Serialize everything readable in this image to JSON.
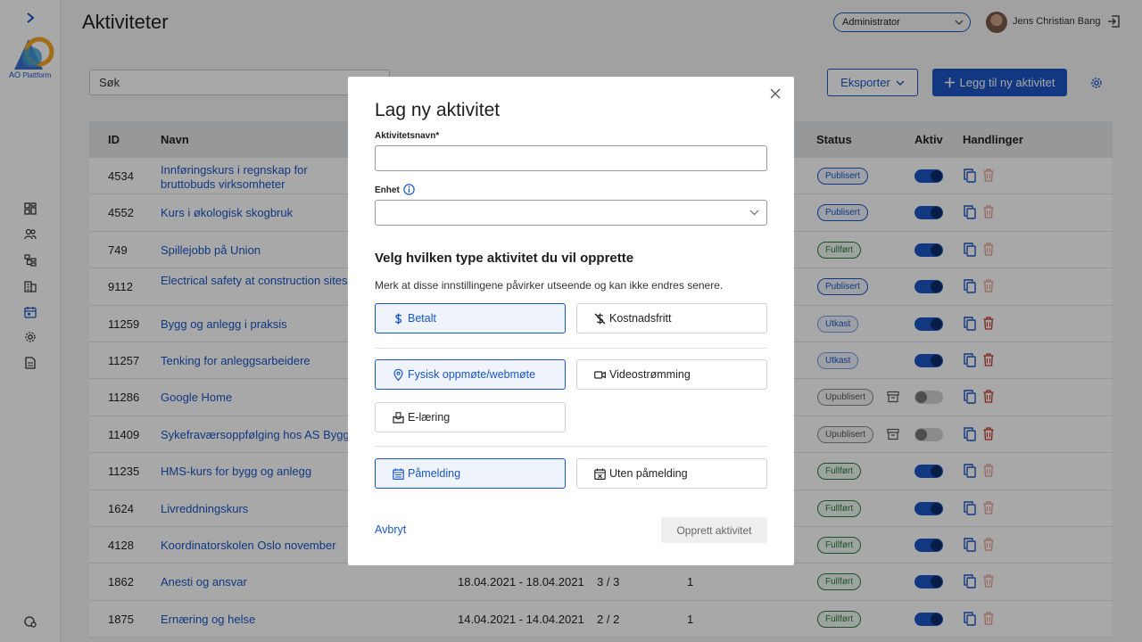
{
  "header": {
    "title": "Aktiviteter",
    "role": "Administrator",
    "user_name": "Jens Christian Bang"
  },
  "logo": {
    "line1": "AO",
    "line2": "Plattform"
  },
  "toolbar": {
    "search_placeholder": "Søk",
    "export_label": "Eksporter",
    "add_label": "Legg til ny aktivitet"
  },
  "table": {
    "columns": {
      "id": "ID",
      "name": "Navn",
      "status": "Status",
      "active": "Aktiv",
      "actions": "Handlinger"
    },
    "rows": [
      {
        "id": "4534",
        "name": "Innføringskurs i regnskap for bruttobuds virksomheter",
        "date": "",
        "seats": "",
        "count": "",
        "status": "Publisert",
        "active": true
      },
      {
        "id": "4552",
        "name": "Kurs i økologisk skogbruk",
        "date": "",
        "seats": "",
        "count": "",
        "status": "Publisert",
        "active": true
      },
      {
        "id": "749",
        "name": "Spillejobb på Union",
        "date": "",
        "seats": "",
        "count": "",
        "status": "Fullført",
        "active": true
      },
      {
        "id": "9112",
        "name": "Electrical safety at construction sites",
        "date": "",
        "seats": "",
        "count": "",
        "status": "Publisert",
        "active": true
      },
      {
        "id": "11259",
        "name": "Bygg og anlegg i praksis",
        "date": "",
        "seats": "",
        "count": "",
        "status": "Utkast",
        "active": true
      },
      {
        "id": "11257",
        "name": "Tenking for anleggsarbeidere",
        "date": "",
        "seats": "",
        "count": "",
        "status": "Utkast",
        "active": true
      },
      {
        "id": "11286",
        "name": "Google Home",
        "date": "",
        "seats": "",
        "count": "",
        "status": "Upublisert",
        "active": false
      },
      {
        "id": "11409",
        "name": "Sykefraværsoppfølging hos AS Bygg",
        "date": "",
        "seats": "",
        "count": "",
        "status": "Upublisert",
        "active": false
      },
      {
        "id": "11235",
        "name": "HMS-kurs for bygg og anlegg",
        "date": "",
        "seats": "",
        "count": "",
        "status": "Fullført",
        "active": true
      },
      {
        "id": "1624",
        "name": "Livreddningskurs",
        "date": "",
        "seats": "",
        "count": "",
        "status": "Fullført",
        "active": true
      },
      {
        "id": "4128",
        "name": "Koordinatorskolen Oslo november",
        "date": "",
        "seats": "",
        "count": "",
        "status": "Fullført",
        "active": true
      },
      {
        "id": "1862",
        "name": "Anesti og ansvar",
        "date": "18.04.2021 - 18.04.2021",
        "seats": "3 / 3",
        "count": "1",
        "status": "Fullført",
        "active": true
      },
      {
        "id": "1875",
        "name": "Ernæring og helse",
        "date": "14.04.2021 - 14.04.2021",
        "seats": "2 / 2",
        "count": "1",
        "status": "Fullført",
        "active": true
      }
    ]
  },
  "modal": {
    "title": "Lag ny aktivitet",
    "name_label": "Aktivitetsnavn*",
    "unit_label": "Enhet",
    "type_heading": "Velg hvilken type aktivitet du vil opprette",
    "type_note": "Merk at disse innstillingene påvirker utseende og kan ikke endres senere.",
    "options": {
      "paid": "Betalt",
      "free": "Kostnadsfritt",
      "physical": "Fysisk oppmøte/webmøte",
      "video": "Videostrømming",
      "elearning": "E-læring",
      "signup": "Påmelding",
      "no_signup": "Uten påmelding"
    },
    "cancel_label": "Avbryt",
    "create_label": "Opprett aktivitet"
  },
  "colors": {
    "accent": "#1a56c4",
    "success": "#2d7a3e",
    "danger": "#c0392b"
  }
}
